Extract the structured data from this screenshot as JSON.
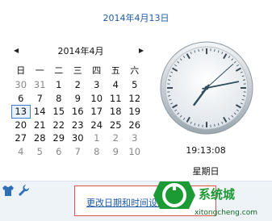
{
  "header": {
    "full_date": "2014年4月13日"
  },
  "calendar": {
    "month_title": "2014年4月",
    "prev_arrow": "◀",
    "next_arrow": "▶",
    "weekdays": [
      "日",
      "一",
      "二",
      "三",
      "四",
      "五",
      "六"
    ],
    "weeks": [
      [
        {
          "d": "30",
          "o": true
        },
        {
          "d": "31",
          "o": true
        },
        {
          "d": "1"
        },
        {
          "d": "2"
        },
        {
          "d": "3"
        },
        {
          "d": "4"
        },
        {
          "d": "5"
        }
      ],
      [
        {
          "d": "6"
        },
        {
          "d": "7"
        },
        {
          "d": "8"
        },
        {
          "d": "9"
        },
        {
          "d": "10"
        },
        {
          "d": "11"
        },
        {
          "d": "12"
        }
      ],
      [
        {
          "d": "13",
          "t": true
        },
        {
          "d": "14"
        },
        {
          "d": "15"
        },
        {
          "d": "16"
        },
        {
          "d": "17"
        },
        {
          "d": "18"
        },
        {
          "d": "19"
        }
      ],
      [
        {
          "d": "20"
        },
        {
          "d": "21"
        },
        {
          "d": "22"
        },
        {
          "d": "23"
        },
        {
          "d": "24"
        },
        {
          "d": "25"
        },
        {
          "d": "26"
        }
      ],
      [
        {
          "d": "27"
        },
        {
          "d": "28"
        },
        {
          "d": "29"
        },
        {
          "d": "30"
        },
        {
          "d": "1",
          "o": true
        },
        {
          "d": "2",
          "o": true
        },
        {
          "d": "3",
          "o": true
        }
      ],
      [
        {
          "d": "4",
          "o": true
        },
        {
          "d": "5",
          "o": true
        },
        {
          "d": "6",
          "o": true
        },
        {
          "d": "7",
          "o": true
        },
        {
          "d": "8",
          "o": true
        },
        {
          "d": "9",
          "o": true
        },
        {
          "d": "10",
          "o": true
        }
      ]
    ]
  },
  "clock": {
    "time_text": "19:13:08",
    "weekday": "星期日",
    "hour": 19,
    "minute": 13,
    "second": 8
  },
  "footer": {
    "change_link": "更改日期和时间设置..."
  },
  "watermark": {
    "text": "系统城",
    "domain": "xitongcheng.com"
  },
  "colors": {
    "accent": "#1e5aa8",
    "today_border": "#3b7dd8",
    "highlight_box": "#d9534f",
    "watermark_green": "#1c9b34"
  }
}
